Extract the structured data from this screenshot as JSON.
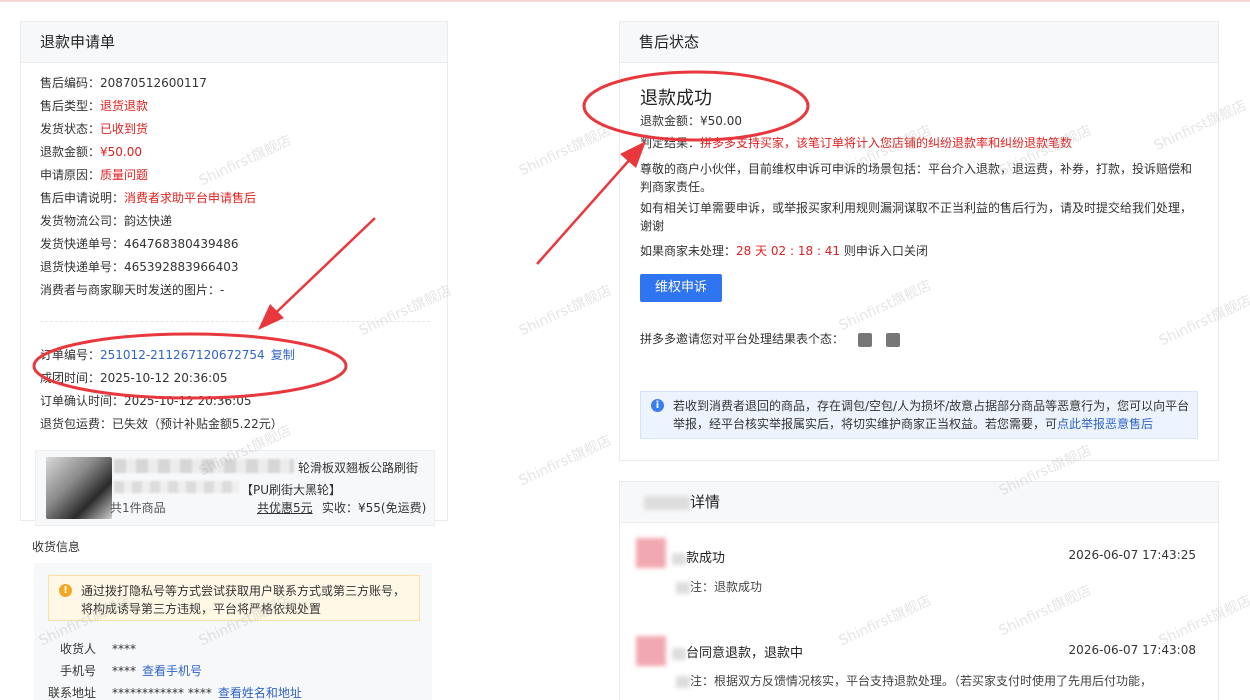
{
  "left": {
    "title": "退款申请单",
    "fields": [
      {
        "label": "售后编码：",
        "value": "20870512600117",
        "color": "normal"
      },
      {
        "label": "售后类型：",
        "value": "退货退款",
        "color": "red"
      },
      {
        "label": "发货状态：",
        "value": "已收到货",
        "color": "red"
      },
      {
        "label": "退款金额：",
        "value": "¥50.00",
        "color": "red"
      },
      {
        "label": "申请原因：",
        "value": "质量问题",
        "color": "red"
      },
      {
        "label": "售后申请说明：",
        "value": "消费者求助平台申请售后",
        "color": "red"
      },
      {
        "label": "发货物流公司：",
        "value": "韵达快递",
        "color": "normal"
      },
      {
        "label": "发货快递单号：",
        "value": "464768380439486",
        "color": "normal"
      },
      {
        "label": "退货快递单号：",
        "value": "465392883966403",
        "color": "normal"
      },
      {
        "label": "消费者与商家聊天时发送的图片：",
        "value": "-",
        "color": "normal"
      }
    ],
    "order": {
      "order_no_label": "订单编号：",
      "order_no": "251012-211267120672754",
      "copy_label": "复制",
      "deal_time_label": "成团时间：",
      "deal_time": "2025-10-12 20:36:05",
      "confirm_time_label": "订单确认时间：",
      "confirm_time": "2025-10-12 20:36:05",
      "return_fee_label": "退货包运费：",
      "return_fee": "已失效（预计补贴金额5.22元）"
    },
    "product": {
      "title": "轮滑板双翘板公路刷街",
      "sub": "【PU刷街大黑轮】",
      "count": "共1件商品",
      "discount": "共优惠5元",
      "pay": "实收：¥55(免运费)"
    },
    "receiver": {
      "section_title": "收货信息",
      "warning": "通过拨打隐私号等方式尝试获取用户联系方式或第三方账号，将构成诱导第三方违规，平台将严格依规处置",
      "name_label": "收货人",
      "name_value": "****",
      "phone_label": "手机号",
      "phone_value": "****",
      "phone_link": "查看手机号",
      "address_label": "联系地址",
      "address_value": "************ ****",
      "address_link": "查看姓名和地址"
    }
  },
  "right": {
    "title": "售后状态",
    "status": "退款成功",
    "refund_amount_label": "退款金额：",
    "refund_amount": "¥50.00",
    "verdict_label": "判定结果：",
    "verdict": "拼多多支持买家，该笔订单将计入您店铺的纠纷退款率和纠纷退款笔数",
    "notice1": "尊敬的商户小伙伴，目前维权申诉可申诉的场景包括：平台介入退款，退运费，补券，打款，投诉赔偿和判商家责任。",
    "notice2": "如有相关订单需要申诉，或举报买家利用规则漏洞谋取不正当利益的售后行为，请及时提交给我们处理，谢谢",
    "countdown_prefix": "如果商家未处理：",
    "countdown": "28 天 02 : 18 : 41",
    "countdown_suffix": "则申诉入口关闭",
    "appeal_button": "维权申诉",
    "feedback_prompt": "拼多多邀请您对平台处理结果表个态：",
    "info_text": "若收到消费者退回的商品，存在调包/空包/人为损坏/故意占据部分商品等恶意行为，您可以向平台举报，经平台核实举报属实后，将切实维护商家正当权益。若您需要，可",
    "info_link": "点此举报恶意售后"
  },
  "detail": {
    "title_suffix": "详情",
    "items": [
      {
        "title": "款成功",
        "time": "2026-06-07 17:43:25",
        "note": "注：退款成功"
      },
      {
        "title": "台同意退款，退款中",
        "time": "2026-06-07 17:43:08",
        "note": "注：根据双方反馈情况核实，平台支持退款处理。（若买家支付时使用了先用后付功能，"
      }
    ]
  },
  "watermark": "Shinfirst旗舰店",
  "colors": {
    "accent": "#2f74f0",
    "red": "#e02020",
    "annotation": "#e8383d",
    "link": "#2f64c8"
  }
}
